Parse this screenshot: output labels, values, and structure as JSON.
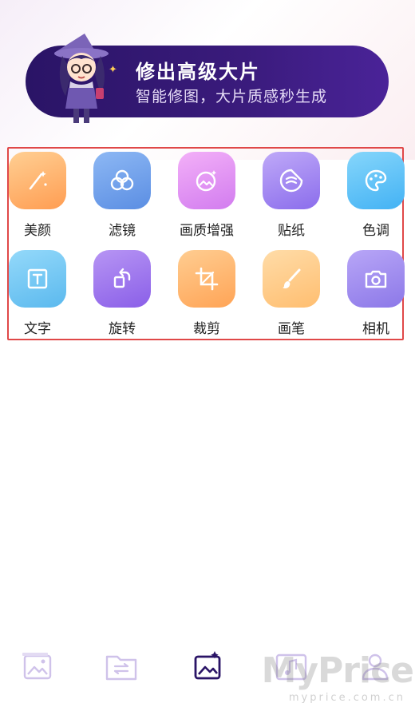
{
  "banner": {
    "title": "修出高级大片",
    "subtitle": "智能修图，大片质感秒生成"
  },
  "tools": [
    {
      "label": "美颜",
      "icon": "magic-wand-icon",
      "color_from": "#ffc98a",
      "color_to": "#ff9f55"
    },
    {
      "label": "滤镜",
      "icon": "filter-circles-icon",
      "color_from": "#84b3f3",
      "color_to": "#5c8fe4"
    },
    {
      "label": "画质增强",
      "icon": "image-enhance-icon",
      "color_from": "#f0a7f7",
      "color_to": "#d97ef0"
    },
    {
      "label": "贴纸",
      "icon": "sticker-icon",
      "color_from": "#b9a2f7",
      "color_to": "#8f73ee"
    },
    {
      "label": "色调",
      "icon": "palette-icon",
      "color_from": "#7fd3fb",
      "color_to": "#48b5f5"
    },
    {
      "label": "文字",
      "icon": "text-icon",
      "color_from": "#8fd7f9",
      "color_to": "#5fbdf0"
    },
    {
      "label": "旋转",
      "icon": "rotate-icon",
      "color_from": "#b28df3",
      "color_to": "#8b61e9"
    },
    {
      "label": "裁剪",
      "icon": "crop-icon",
      "color_from": "#ffc98a",
      "color_to": "#ffa65a"
    },
    {
      "label": "画笔",
      "icon": "brush-icon",
      "color_from": "#ffd9a3",
      "color_to": "#ffbf73"
    },
    {
      "label": "相机",
      "icon": "camera-icon",
      "color_from": "#b3a1f6",
      "color_to": "#8e7be9"
    }
  ],
  "bottom_nav": [
    {
      "name": "gallery-icon",
      "active": false
    },
    {
      "name": "folder-transfer-icon",
      "active": false
    },
    {
      "name": "edit-image-icon",
      "active": true
    },
    {
      "name": "music-video-icon",
      "active": false
    },
    {
      "name": "profile-icon",
      "active": false
    }
  ],
  "watermark": {
    "brand": "MyPrice",
    "domain": "myprice.com.cn"
  },
  "colors": {
    "accent": "#3a1b7c",
    "nav_inactive": "#cfc2ea",
    "frame_red": "#e04848"
  }
}
